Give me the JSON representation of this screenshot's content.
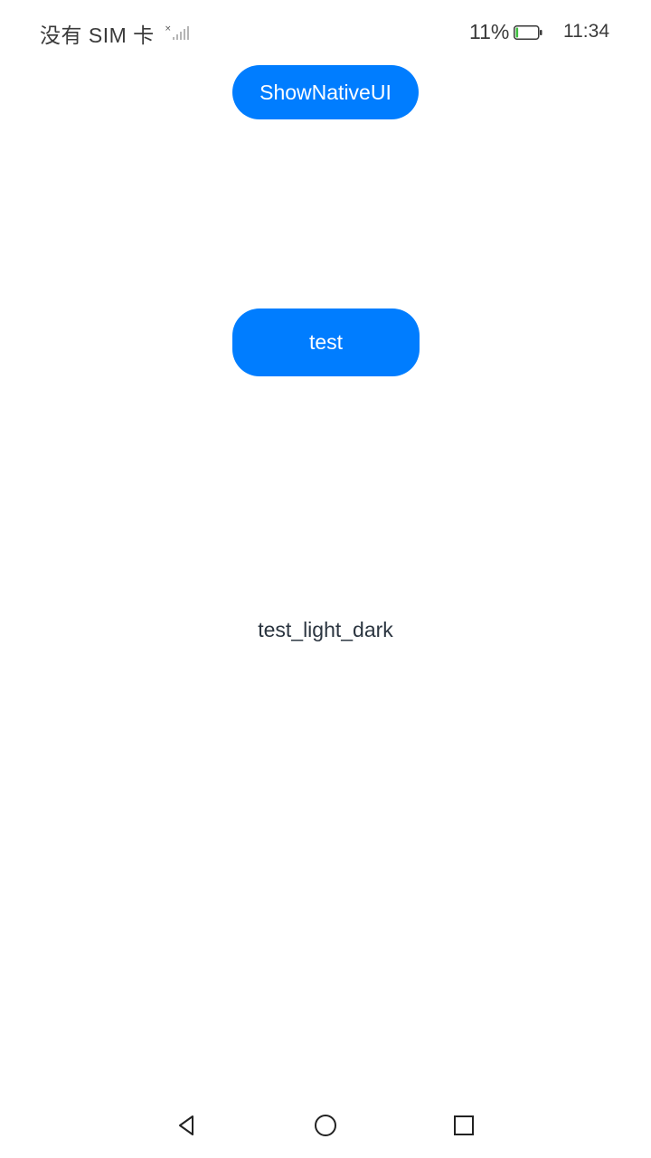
{
  "status_bar": {
    "carrier": "没有 SIM 卡",
    "battery_percent": "11%",
    "battery_level": 0.11,
    "time": "11:34",
    "signal_icon": "no-signal-icon",
    "battery_icon": "battery-low-icon"
  },
  "main": {
    "show_native_button": "ShowNativeUI",
    "test_button": "test",
    "light_dark_label": "test_light_dark"
  },
  "navigation": {
    "back_icon": "back-triangle-icon",
    "home_icon": "home-circle-icon",
    "recent_icon": "recent-square-icon"
  },
  "colors": {
    "accent": "#007dff",
    "text": "#2b3540",
    "status_text": "#3a3a3a",
    "battery_fill": "#3fbf3f"
  }
}
